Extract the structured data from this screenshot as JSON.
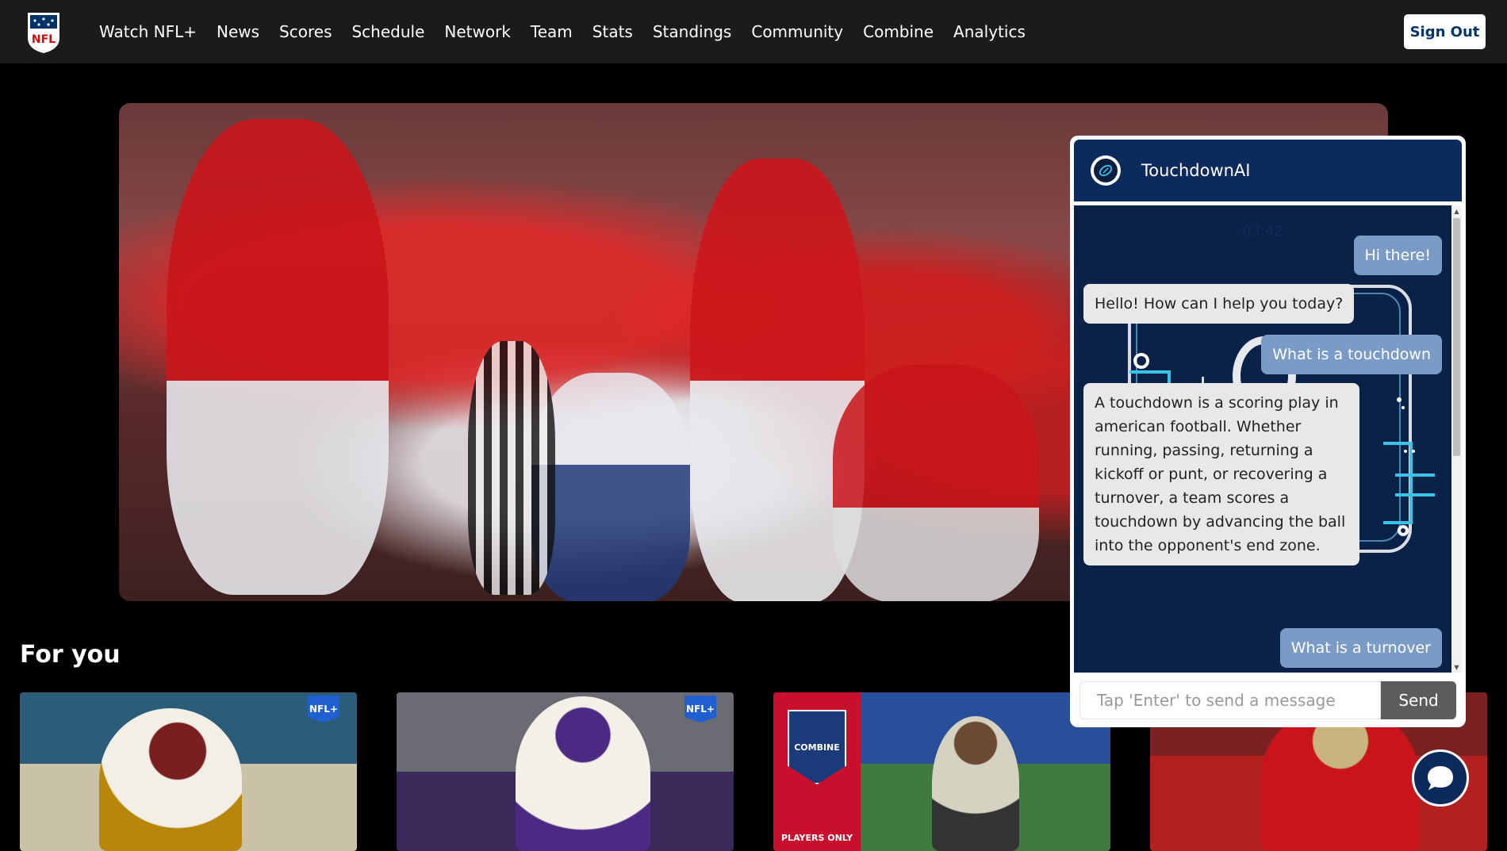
{
  "nav": {
    "logo_icon": "nfl-shield-logo",
    "items": [
      {
        "label": "Watch NFL+"
      },
      {
        "label": "News"
      },
      {
        "label": "Scores"
      },
      {
        "label": "Schedule"
      },
      {
        "label": "Network"
      },
      {
        "label": "Team"
      },
      {
        "label": "Stats"
      },
      {
        "label": "Standings"
      },
      {
        "label": "Community"
      },
      {
        "label": "Combine"
      },
      {
        "label": "Analytics"
      }
    ],
    "signout_label": "Sign Out"
  },
  "section": {
    "title": "For you"
  },
  "cards": [
    {
      "badge": "NFL+",
      "colors": [
        "#2b5d7a",
        "#c9c2a6"
      ]
    },
    {
      "badge": "NFL+",
      "colors": [
        "#6b6b73",
        "#4a2a73"
      ]
    },
    {
      "badge": "",
      "combine_text": "COMBINE",
      "caption": "PLAYERS ONLY",
      "colors": [
        "#c8102e",
        "#2a4f9a"
      ]
    },
    {
      "badge": "",
      "colors": [
        "#7a2222",
        "#c8c8c8"
      ]
    }
  ],
  "chat": {
    "title": "TouchdownAI",
    "timestamp": "03:42",
    "messages": [
      {
        "role": "user",
        "text": "Hi there!"
      },
      {
        "role": "bot",
        "text": "Hello! How can I help you today?"
      },
      {
        "role": "user",
        "text": "What is a touchdown"
      },
      {
        "role": "bot",
        "text": "A touchdown is a scoring play in american football. Whether running, passing, returning a kickoff or punt, or recovering a turnover, a team scores a touchdown by advancing the ball into the opponent's end zone."
      },
      {
        "role": "user",
        "text": "What is a turnover"
      }
    ],
    "input_placeholder": "Tap 'Enter' to send a message",
    "send_label": "Send",
    "accent": "#0c2a5c"
  }
}
